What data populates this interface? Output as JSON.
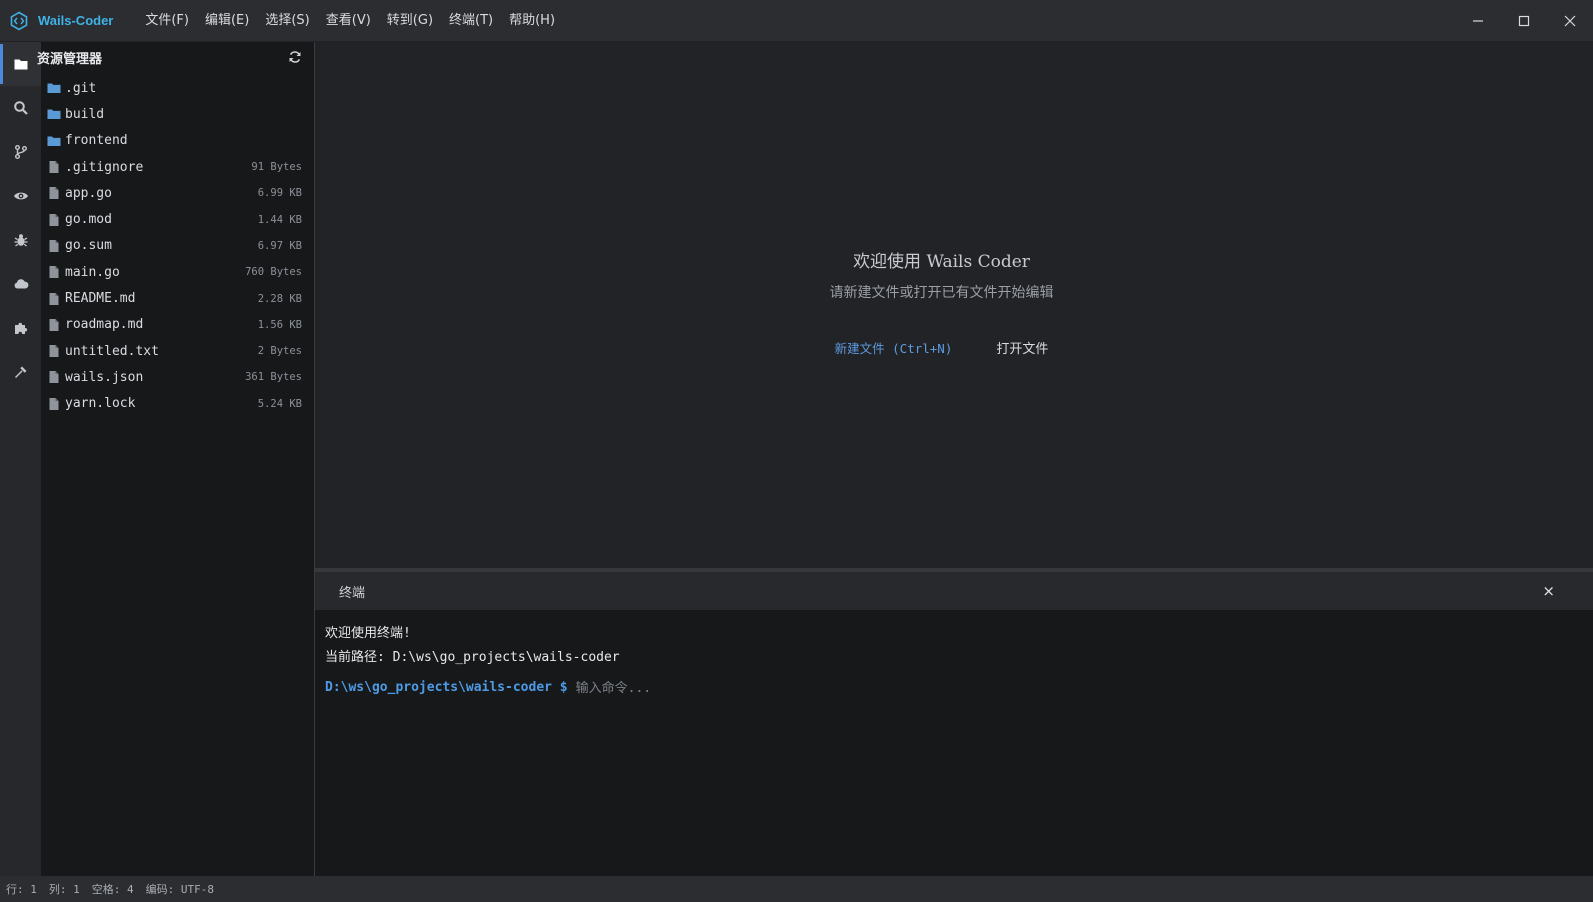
{
  "titlebar": {
    "app_name": "Wails-Coder",
    "menu": [
      {
        "label": "文件(F)"
      },
      {
        "label": "编辑(E)"
      },
      {
        "label": "选择(S)"
      },
      {
        "label": "查看(V)"
      },
      {
        "label": "转到(G)"
      },
      {
        "label": "终端(T)"
      },
      {
        "label": "帮助(H)"
      }
    ],
    "window_controls": [
      "minimize-icon",
      "maximize-icon",
      "close-icon"
    ]
  },
  "activity_bar": [
    {
      "icon": "folder-icon",
      "active": true
    },
    {
      "icon": "search-icon"
    },
    {
      "icon": "source-control-icon"
    },
    {
      "icon": "eye-icon"
    },
    {
      "icon": "bug-icon"
    },
    {
      "icon": "cloud-icon"
    },
    {
      "icon": "puzzle-icon"
    },
    {
      "icon": "hammer-icon"
    }
  ],
  "explorer": {
    "title": "资源管理器",
    "files": [
      {
        "name": ".git",
        "type": "folder",
        "size": ""
      },
      {
        "name": "build",
        "type": "folder",
        "size": ""
      },
      {
        "name": "frontend",
        "type": "folder",
        "size": ""
      },
      {
        "name": ".gitignore",
        "type": "file",
        "size": "91 Bytes"
      },
      {
        "name": "app.go",
        "type": "file",
        "size": "6.99 KB"
      },
      {
        "name": "go.mod",
        "type": "file",
        "size": "1.44 KB"
      },
      {
        "name": "go.sum",
        "type": "file",
        "size": "6.97 KB"
      },
      {
        "name": "main.go",
        "type": "file",
        "size": "760 Bytes"
      },
      {
        "name": "README.md",
        "type": "file",
        "size": "2.28 KB"
      },
      {
        "name": "roadmap.md",
        "type": "file",
        "size": "1.56 KB"
      },
      {
        "name": "untitled.txt",
        "type": "file",
        "size": "2 Bytes"
      },
      {
        "name": "wails.json",
        "type": "file",
        "size": "361 Bytes"
      },
      {
        "name": "yarn.lock",
        "type": "file",
        "size": "5.24 KB"
      }
    ]
  },
  "welcome": {
    "title": "欢迎使用 Wails Coder",
    "subtitle": "请新建文件或打开已有文件开始编辑",
    "new_file": "新建文件 (Ctrl+N)",
    "open_file": "打开文件"
  },
  "terminal": {
    "title": "终端",
    "close": "×",
    "lines": [
      "欢迎使用终端!",
      "当前路径: D:\\ws\\go_projects\\wails-coder"
    ],
    "prompt": "D:\\ws\\go_projects\\wails-coder $",
    "input_placeholder": "输入命令...",
    "input_value": ""
  },
  "statusbar": {
    "line": "行: 1",
    "column": "列: 1",
    "spaces": "空格: 4",
    "encoding": "编码: UTF-8"
  },
  "colors": {
    "accent": "#3fb3e8",
    "link": "#5d9be0",
    "folder": "#5b9bd5",
    "prompt": "#4d9be6"
  }
}
